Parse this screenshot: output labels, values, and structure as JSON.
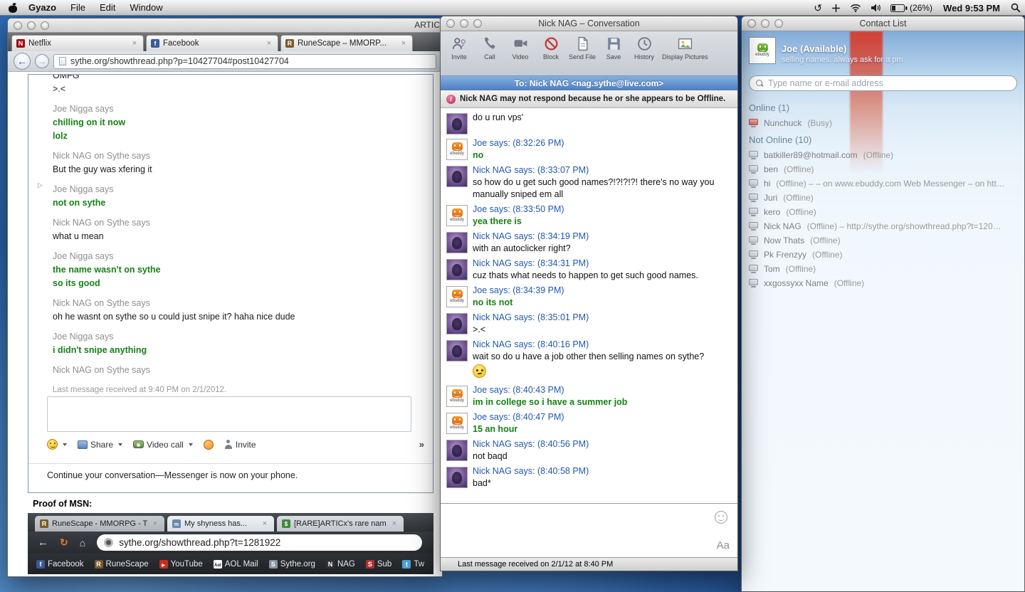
{
  "menu_bar": {
    "app_name": "Gyazo",
    "menus": [
      "File",
      "Edit",
      "Window"
    ],
    "battery_pct": "(26%)",
    "clock": "Wed 9:53 PM"
  },
  "browser": {
    "window_title": "ARTIC",
    "tabs": [
      "Netflix",
      "Facebook",
      "RuneScape – MMORP..."
    ],
    "url": "sythe.org/showthread.php?p=10427704#post10427704",
    "msn_log": {
      "blocks": [
        {
          "sender": "",
          "lines": [
            "OMFG",
            ">.<"
          ]
        },
        {
          "sender": "Joe Nigga says",
          "lines": [
            "chilling on it now",
            "lolz"
          ]
        },
        {
          "sender": "Nick NAG on Sythe says",
          "lines": [
            "But the guy was xfering it"
          ]
        },
        {
          "sender": "Joe Nigga says",
          "lines": [
            "not on sythe"
          ]
        },
        {
          "sender": "Nick NAG on Sythe says",
          "lines": [
            "what u mean"
          ]
        },
        {
          "sender": "Joe Nigga says",
          "lines": [
            "the name wasn't on sythe",
            "so its good"
          ]
        },
        {
          "sender": "Nick NAG on Sythe says",
          "lines": [
            "oh he wasnt on sythe so u could just snipe it? haha nice dude"
          ]
        },
        {
          "sender": "Joe Nigga says",
          "lines": [
            "i didn't snipe anything"
          ]
        },
        {
          "sender": "Nick NAG on Sythe says",
          "lines": []
        }
      ],
      "last_note": "Last message received at 9:40 PM on 2/1/2012.",
      "share": "Share",
      "video_call": "Video call",
      "invite": "Invite",
      "more": "»",
      "footer": "Continue your conversation—Messenger is now on your phone."
    },
    "proof_label": "Proof of MSN:",
    "chrome_shot": {
      "tabs": [
        "RuneScape - MMORPG - Th",
        "My shyness has...",
        "[RARE]ARTICx's rare name s"
      ],
      "url": "sythe.org/showthread.php?t=1281922",
      "bookmarks": [
        "Facebook",
        "RuneScape",
        "YouTube",
        "AOL Mail",
        "Sythe.org",
        "NAG",
        "Sub",
        "Tw"
      ]
    }
  },
  "conversation": {
    "title": "Nick NAG – Conversation",
    "toolbar": [
      "Invite",
      "Call",
      "Video",
      "Block",
      "Send File",
      "Save",
      "History",
      "Display Pictures"
    ],
    "to_line": "To: Nick NAG <nag.sythe@live.com>",
    "warning": "Nick NAG may not respond because he or she appears to be Offline.",
    "messages": [
      {
        "header": "",
        "text": "do u run vps'"
      },
      {
        "header": "Joe says: (8:32:26 PM)",
        "text": "no"
      },
      {
        "header": "Nick NAG says: (8:33:07 PM)",
        "text": "so how do u get such good names?!?!?!?! there's no way you manually sniped em all"
      },
      {
        "header": "Joe says: (8:33:50 PM)",
        "text": "yea there is"
      },
      {
        "header": "Nick NAG says: (8:34:19 PM)",
        "text": "with an autoclicker right?"
      },
      {
        "header": "Nick NAG says: (8:34:31 PM)",
        "text": "cuz thats what needs to happen to get such good names."
      },
      {
        "header": "Joe says: (8:34:39 PM)",
        "text": "no its not"
      },
      {
        "header": "Nick NAG says: (8:35:01 PM)",
        "text": ">.<"
      },
      {
        "header": "Nick NAG says: (8:40:16 PM)",
        "text": "wait so do u have a job other then selling names on sythe?"
      },
      {
        "header": "Joe says: (8:40:43 PM)",
        "text": "im in college so i have a summer job"
      },
      {
        "header": "Joe says: (8:40:47 PM)",
        "text": "15 an hour"
      },
      {
        "header": "Nick NAG says: (8:40:56 PM)",
        "text": "not baqd"
      },
      {
        "header": "Nick NAG says: (8:40:58 PM)",
        "text": "bad*"
      }
    ],
    "format_icon": "Aa",
    "status_bar": "Last message received on 2/1/12 at 8:40 PM"
  },
  "contact_list": {
    "title": "Contact List",
    "me": {
      "name": "Joe (Available)",
      "status_message": "selling names. always ask for a pm"
    },
    "search_placeholder": "Type name or e-mail address",
    "sections": [
      {
        "header": "Online (1)",
        "contacts": [
          {
            "name": "Nunchuck",
            "status": "(Busy)"
          }
        ]
      },
      {
        "header": "Not Online (10)",
        "contacts": [
          {
            "name": "batkiller89@hotmail.com",
            "status": "(Offline)"
          },
          {
            "name": "ben",
            "status": "(Offline)"
          },
          {
            "name": "hi",
            "status": "(Offline) – – on www.ebuddy.com Web Messenger – on htt…"
          },
          {
            "name": "Juri",
            "status": "(Offline)"
          },
          {
            "name": "kero",
            "status": "(Offline)"
          },
          {
            "name": "Nick NAG",
            "status": "(Offline) – http://sythe.org/showthread.php?t=120…"
          },
          {
            "name": "Now Thats",
            "status": "(Offline)"
          },
          {
            "name": "Pk Frenzyy",
            "status": "(Offline)"
          },
          {
            "name": "Tom",
            "status": "(Offline)"
          },
          {
            "name": "xxgossyxx Name",
            "status": "(Offline)"
          }
        ]
      }
    ]
  }
}
